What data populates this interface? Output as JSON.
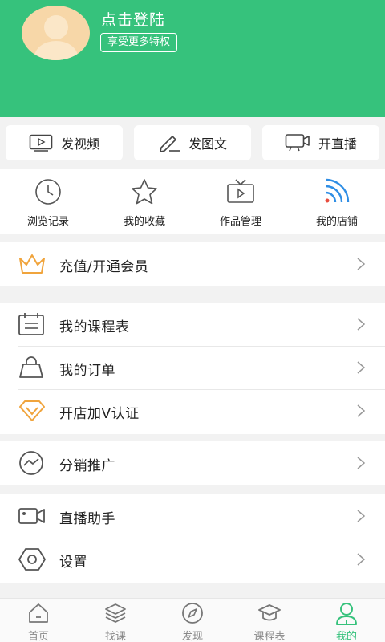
{
  "header": {
    "login_text": "点击登陆",
    "privilege_badge": "享受更多特权",
    "bg_color": "#36c27c"
  },
  "quick_actions": [
    {
      "label": "发视频",
      "icon": "video-icon"
    },
    {
      "label": "发图文",
      "icon": "pencil-icon"
    },
    {
      "label": "开直播",
      "icon": "live-camera-icon"
    }
  ],
  "grid": [
    {
      "label": "浏览记录",
      "icon": "clock-icon"
    },
    {
      "label": "我的收藏",
      "icon": "star-icon"
    },
    {
      "label": "作品管理",
      "icon": "tv-icon"
    },
    {
      "label": "我的店铺",
      "icon": "signal-icon"
    }
  ],
  "menu": {
    "vip": "充值/开通会员",
    "schedule": "我的课程表",
    "orders": "我的订单",
    "shop_verify": "开店加V认证",
    "distribution": "分销推广",
    "live_assistant": "直播助手",
    "settings": "设置"
  },
  "tabs": [
    {
      "label": "首页",
      "icon": "home-icon"
    },
    {
      "label": "找课",
      "icon": "layers-icon"
    },
    {
      "label": "发现",
      "icon": "compass-icon"
    },
    {
      "label": "课程表",
      "icon": "graduation-cap-icon"
    },
    {
      "label": "我的",
      "icon": "user-icon",
      "active": true
    }
  ],
  "colors": {
    "accent": "#36c27c",
    "gold": "#f0a43c",
    "icon_gray": "#555555"
  }
}
